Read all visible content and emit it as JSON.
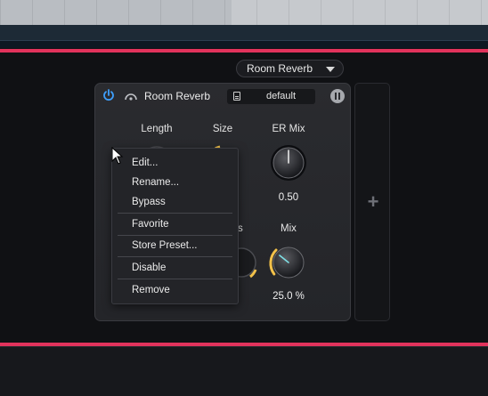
{
  "app": {
    "rack_preset_dropdown": {
      "label": "Room Reverb"
    }
  },
  "device": {
    "name": "Room Reverb",
    "preset": "default",
    "params": [
      {
        "label": "Length",
        "value": ""
      },
      {
        "label": "Size",
        "value": ""
      },
      {
        "label": "ER Mix",
        "value": "0.50"
      },
      {
        "label": "ss",
        "value": ""
      },
      {
        "label": "Mix",
        "value": "25.0 %"
      }
    ],
    "levels": {
      "er_mix": 0.5,
      "mix": 0.25
    }
  },
  "context_menu": {
    "items": [
      "Edit...",
      "Rename...",
      "Bypass",
      "Favorite",
      "Store Preset...",
      "Disable",
      "Remove"
    ]
  },
  "empty_slot": {
    "label": "+"
  },
  "colors": {
    "accent_pink": "#e2335c",
    "power_blue": "#3ea0ff",
    "knob_arc_yellow": "#f2c14a"
  },
  "icons": [
    "power-icon",
    "sidechain-icon",
    "file-icon",
    "editor-icon",
    "mouse-cursor-icon",
    "chevron-down-icon"
  ]
}
